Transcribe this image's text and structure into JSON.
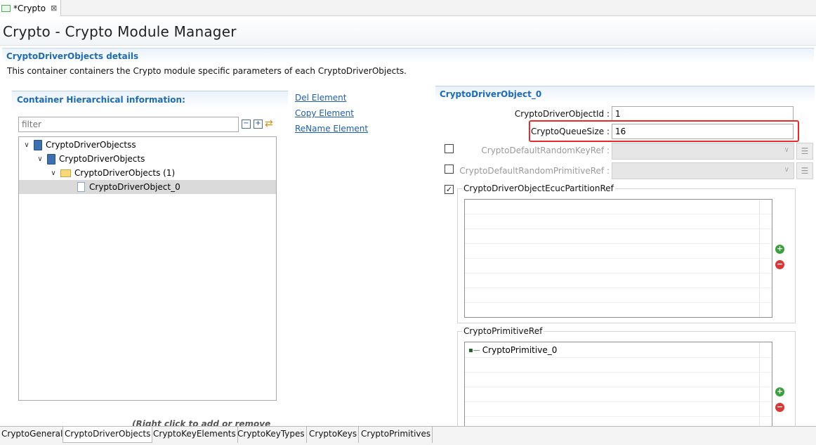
{
  "editor_tab": {
    "label": "*Crypto",
    "close": "⊠"
  },
  "header": {
    "title": "Crypto - Crypto Module Manager"
  },
  "details": {
    "title": "CryptoDriverObjects details",
    "description": "This container containers the Crypto module specific parameters of each CryptoDriverObjects."
  },
  "left_panel": {
    "title": "Container Hierarchical information:",
    "filter_placeholder": "filter",
    "tree": [
      {
        "label": "CryptoDriverObjectss",
        "level": 0,
        "icon": "module-icon",
        "toggle": "∨"
      },
      {
        "label": "CryptoDriverObjects",
        "level": 1,
        "icon": "module-icon",
        "toggle": "∨"
      },
      {
        "label": "CryptoDriverObjects (1)",
        "level": 2,
        "icon": "folder-icon",
        "toggle": "∨"
      },
      {
        "label": "CryptoDriverObject_0",
        "level": 3,
        "icon": "file-icon",
        "toggle": ""
      }
    ],
    "hint": "(Right click to add or remove items)"
  },
  "links": {
    "del": "Del Element",
    "copy": "Copy Element",
    "rename": "ReName Element"
  },
  "right_panel": {
    "title": "CryptoDriverObject_0",
    "object_id_label": "CryptoDriverObjectId :",
    "object_id_value": "1",
    "queue_size_label": "CryptoQueueSize :",
    "queue_size_value": "16",
    "random_key_ref_label": "CryptoDefaultRandomKeyRef :",
    "random_primitive_ref_label": "CryptoDefaultRandomPrimitiveRef :",
    "ecuc_partition_ref_label": "CryptoDriverObjectEcucPartitionRef",
    "ecuc_partition_checked": "✓",
    "primitive_ref_label": "CryptoPrimitiveRef",
    "primitive_items": [
      "CryptoPrimitive_0"
    ]
  },
  "bottom_tabs": [
    {
      "label": "CryptoGeneral",
      "active": false
    },
    {
      "label": "CryptoDriverObjects",
      "active": true
    },
    {
      "label": "CryptoKeyElements",
      "active": false
    },
    {
      "label": "CryptoKeyTypes",
      "active": false
    },
    {
      "label": "CryptoKeys",
      "active": false
    },
    {
      "label": "CryptoPrimitives",
      "active": false
    }
  ],
  "colors": {
    "accent": "#1f6bb4",
    "highlight_box": "#e52b2b"
  }
}
